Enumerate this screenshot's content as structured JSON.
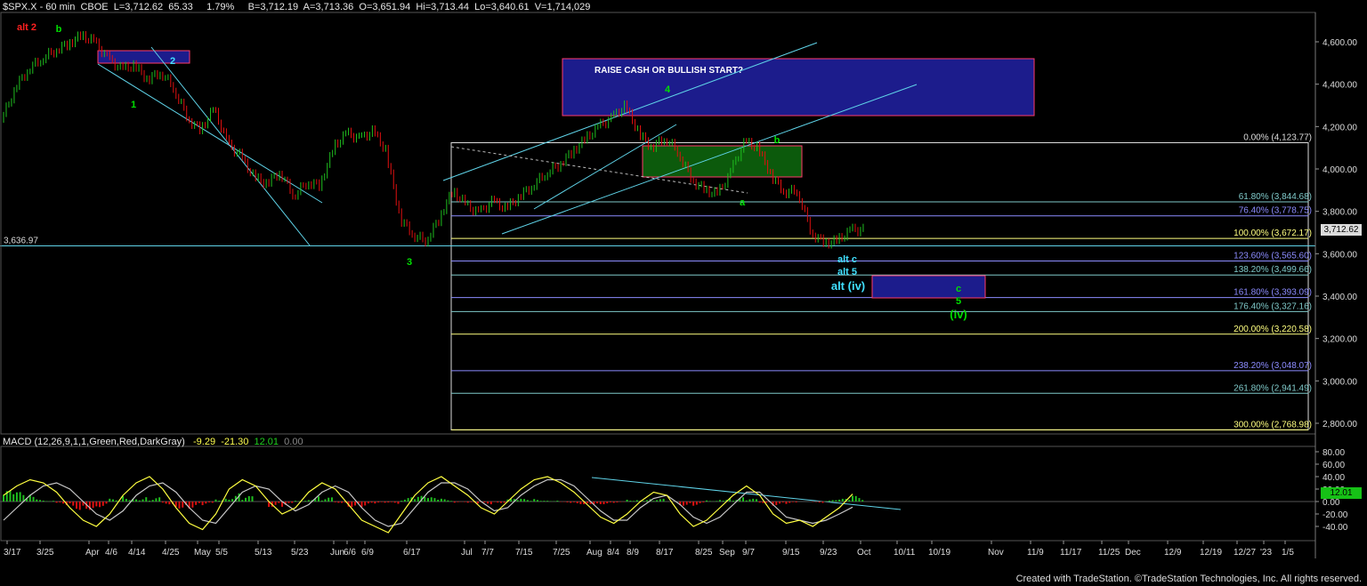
{
  "header": {
    "symbol": "$SPX.X - 60 min",
    "exchange": "CBOE",
    "last": "L=3,712.62",
    "change": "65.33",
    "change_pct": "1.79%",
    "bid": "B=3,712.19",
    "ask": "A=3,713.36",
    "open": "O=3,651.94",
    "high": "Hi=3,713.44",
    "low": "Lo=3,640.61",
    "volume": "V=1,714,029"
  },
  "macd_header": {
    "label": "MACD (12,26,9,1,1,Green,Red,DarkGray)",
    "v1": "-9.29",
    "v2": "-21.30",
    "v3": "12.01",
    "v4": "0.00"
  },
  "footer": "Created with TradeStation. ©TradeStation Technologies, Inc. All rights reserved.",
  "price_box": "3,712.62",
  "macd_box": "12.01",
  "colors": {
    "up": "#1fbf1f",
    "down": "#e01010",
    "fib_yellow": "#ffff80",
    "fib_blue": "#8c8cff",
    "fib_teal": "#7fc9c9",
    "trend_cyan": "#5fd3e8",
    "box_blue": "#1c1c8c",
    "box_green": "#0c5a0c"
  },
  "chart_data": [
    {
      "type": "line",
      "title": "",
      "ylim": [
        2700,
        4800
      ],
      "y_ticks": [
        "4,600.00",
        "4,400.00",
        "4,200.00",
        "4,000.00",
        "3,800.00",
        "3,600.00",
        "3,400.00",
        "3,200.00",
        "3,000.00",
        "2,800.00"
      ],
      "x_ticks": [
        "3/17",
        "3/25",
        "Apr",
        "4/6",
        "4/14",
        "4/25",
        "May",
        "5/5",
        "5/13",
        "5/23",
        "Jun",
        "6/6",
        "6/9",
        "6/17",
        "Jul",
        "7/7",
        "7/15",
        "7/25",
        "Aug",
        "8/4",
        "8/9",
        "8/17",
        "8/25",
        "Sep",
        "9/7",
        "9/15",
        "9/23",
        "Oct",
        "10/11",
        "10/19",
        "Nov",
        "11/9",
        "11/17",
        "11/25",
        "Dec",
        "12/9",
        "12/19",
        "12/27",
        "'23",
        "1/5"
      ],
      "series": [
        {
          "values": [
            4230,
            4380,
            4470,
            4520,
            4560,
            4590,
            4630,
            4600,
            4520,
            4470,
            4490,
            4420,
            4460,
            4380,
            4240,
            4180,
            4290,
            4120,
            4060,
            3960,
            3930,
            3990,
            3870,
            3940,
            3920,
            4100,
            4170,
            4140,
            4180,
            4080,
            3770,
            3690,
            3660,
            3770,
            3900,
            3830,
            3790,
            3850,
            3810,
            3870,
            3920,
            3980,
            4020,
            4080,
            4140,
            4200,
            4240,
            4300,
            4170,
            4100,
            4150,
            4080,
            3950,
            3900,
            3880,
            3990,
            4130,
            4100,
            3970,
            3890,
            3900,
            3700,
            3650,
            3660,
            3712
          ]
        }
      ],
      "hline_label": "3,636.97",
      "fib_levels": [
        {
          "label": "0.00% (4,123.77)",
          "value": 4123.77
        },
        {
          "label": "61.80% (3,844.68)",
          "value": 3844.68
        },
        {
          "label": "76.40% (3,778.75)",
          "value": 3778.75
        },
        {
          "label": "100.00% (3,672.17)",
          "value": 3672.17
        },
        {
          "label": "123.60% (3,565.60)",
          "value": 3565.6
        },
        {
          "label": "138.20% (3,499.66)",
          "value": 3499.66
        },
        {
          "label": "161.80% (3,393.09)",
          "value": 3393.09
        },
        {
          "label": "176.40% (3,327.16)",
          "value": 3327.16
        },
        {
          "label": "200.00% (3,220.58)",
          "value": 3220.58
        },
        {
          "label": "238.20% (3,048.07)",
          "value": 3048.07
        },
        {
          "label": "261.80% (2,941.49)",
          "value": 2941.49
        },
        {
          "label": "300.00% (2,768.98)",
          "value": 2768.98
        }
      ],
      "annotations": {
        "raise_cash": "RAISE CASH OR BULLISH START?",
        "wave_labels": [
          "alt 2",
          "b",
          "2",
          "1",
          "3",
          "4",
          "a",
          "b",
          "alt c",
          "alt 5",
          "alt (iv)",
          "c",
          "5",
          "(iv)"
        ]
      }
    },
    {
      "type": "line",
      "title": "",
      "ylim": [
        -60,
        100
      ],
      "y_ticks": [
        "80.00",
        "60.00",
        "40.00",
        "20.00",
        "0.00",
        "-20.00",
        "-40.00"
      ],
      "series": [
        {
          "values": [
            10,
            25,
            35,
            30,
            15,
            -10,
            -30,
            -40,
            -20,
            10,
            30,
            40,
            20,
            -10,
            -35,
            -45,
            -20,
            20,
            35,
            25,
            0,
            -20,
            -10,
            15,
            30,
            20,
            -5,
            -30,
            -40,
            -50,
            -20,
            10,
            30,
            40,
            25,
            10,
            -10,
            -20,
            0,
            20,
            35,
            40,
            30,
            15,
            -5,
            -25,
            -35,
            -20,
            0,
            15,
            10,
            -20,
            -40,
            -30,
            -10,
            10,
            25,
            10,
            -20,
            -35,
            -30,
            -40,
            -25,
            -10,
            12
          ]
        },
        {
          "values": [
            -30,
            -10,
            10,
            25,
            30,
            20,
            0,
            -20,
            -30,
            -15,
            10,
            25,
            30,
            15,
            -10,
            -30,
            -35,
            -10,
            15,
            25,
            20,
            0,
            -15,
            -5,
            15,
            25,
            15,
            -10,
            -30,
            -40,
            -35,
            -10,
            15,
            30,
            30,
            20,
            0,
            -15,
            -10,
            10,
            25,
            35,
            35,
            25,
            5,
            -15,
            -30,
            -30,
            -10,
            5,
            10,
            -5,
            -25,
            -35,
            -25,
            -5,
            15,
            15,
            -5,
            -25,
            -30,
            -35,
            -30,
            -20,
            -9
          ]
        }
      ]
    }
  ]
}
